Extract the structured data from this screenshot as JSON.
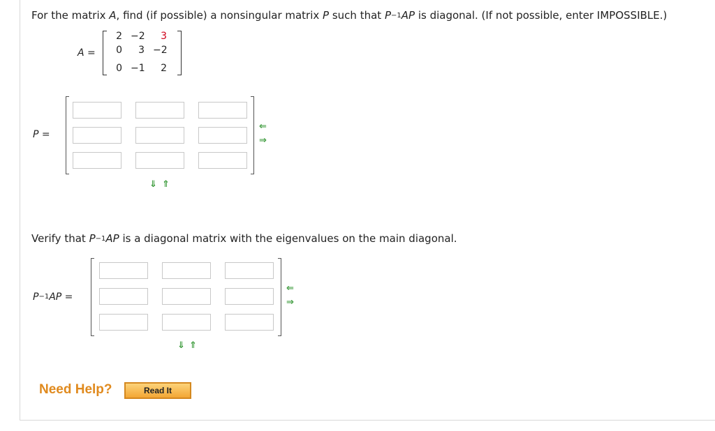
{
  "question": {
    "prefix": "For the matrix ",
    "var_a": "A",
    "mid": ", find (if possible) a nonsingular matrix ",
    "var_p": "P",
    "mid2": " such that ",
    "p": "P",
    "exp": "−1",
    "ap": "AP",
    "suffix": " is diagonal. (If not possible, enter IMPOSSIBLE.)"
  },
  "matrix_a": {
    "label": "A",
    "eq": " =",
    "rows": [
      [
        "2",
        "−2",
        "3"
      ],
      [
        "0",
        "3",
        "−2"
      ],
      [
        "0",
        "−1",
        "2"
      ]
    ],
    "highlight_color": "#d0021b"
  },
  "p_input": {
    "label": "P",
    "eq": " ="
  },
  "verify": {
    "prefix": "Verify that ",
    "p": "P",
    "exp": "−1",
    "ap": "AP",
    "suffix": " is a diagonal matrix with the eigenvalues on the main diagonal."
  },
  "pap_input": {
    "p": "P",
    "exp": "−1",
    "ap": "AP",
    "eq": " ="
  },
  "arrows": {
    "left": "⇐",
    "right": "⇒",
    "down": "⇓",
    "up": "⇑"
  },
  "help": {
    "label": "Need Help?",
    "read_it": "Read It"
  }
}
